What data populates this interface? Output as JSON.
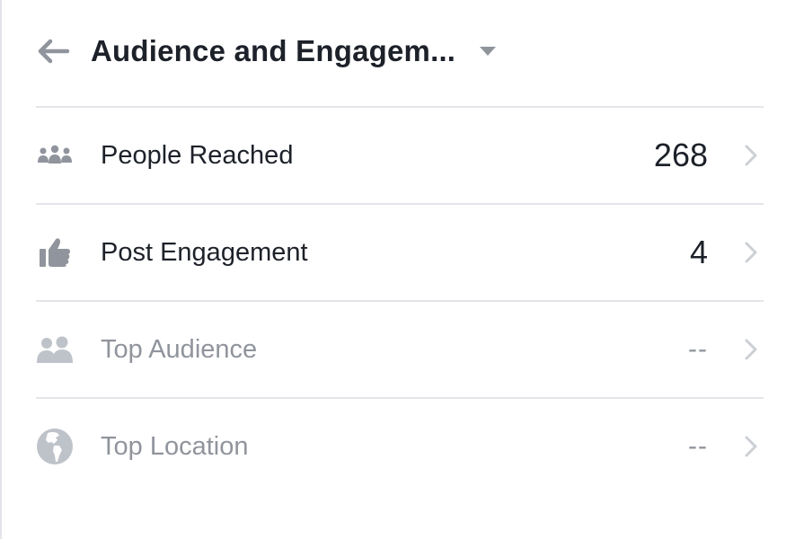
{
  "header": {
    "title": "Audience and Engagem...",
    "back_icon": "arrow-left-icon",
    "dropdown_icon": "caret-down-icon"
  },
  "rows": [
    {
      "label": "People Reached",
      "value": "268",
      "icon": "people-group-icon",
      "enabled": true
    },
    {
      "label": "Post Engagement",
      "value": "4",
      "icon": "thumbs-up-icon",
      "enabled": true
    },
    {
      "label": "Top Audience",
      "value": "--",
      "icon": "two-people-icon",
      "enabled": false
    },
    {
      "label": "Top Location",
      "value": "--",
      "icon": "globe-icon",
      "enabled": false
    }
  ],
  "colors": {
    "text": "#1d2129",
    "muted_text": "#90949c",
    "icon": "#90949c",
    "muted_icon": "#bec2c9",
    "divider": "#e3e5e9",
    "chevron": "#ccd0d5"
  }
}
